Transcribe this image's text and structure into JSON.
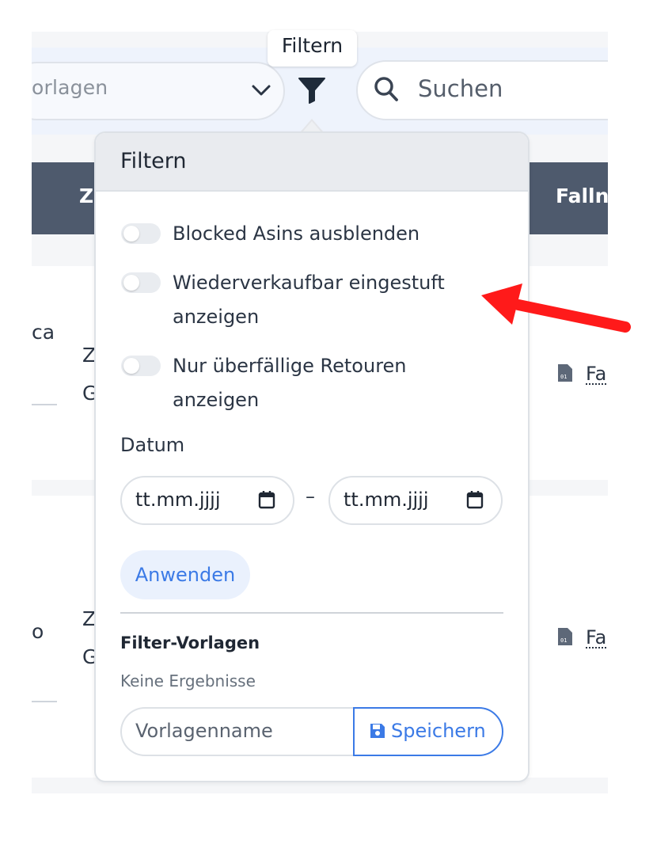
{
  "toolbar": {
    "template_select_value": "orlagen",
    "search_placeholder": "Suchen"
  },
  "tooltip": {
    "text": "Filtern"
  },
  "table": {
    "header_col_z": "Z",
    "header_col_fall": "Fallnu",
    "rows": [
      {
        "left_text": "ca",
        "col2_line1": "Z",
        "col2_line2": "G",
        "file_label": "Fa"
      },
      {
        "left_text": "o",
        "col2_line1": "Z",
        "col2_line2": "G",
        "file_label": "Fa"
      }
    ]
  },
  "filter_popover": {
    "title": "Filtern",
    "toggles": [
      {
        "label": "Blocked Asins ausblenden",
        "on": false
      },
      {
        "label": "Wiederverkaufbar eingestuft anzeigen",
        "on": false
      },
      {
        "label": "Nur überfällige Retouren anzeigen",
        "on": false
      }
    ],
    "date_label": "Datum",
    "date_from_placeholder": "tt.mm.jjjj",
    "date_separator": "–",
    "date_to_placeholder": "tt.mm.jjjj",
    "apply_label": "Anwenden",
    "templates_title": "Filter-Vorlagen",
    "templates_empty": "Keine Ergebnisse",
    "template_name_placeholder": "Vorlagenname",
    "save_label": "Speichern"
  },
  "colors": {
    "accent": "#3b7ae6",
    "header_bg": "#4e5a6d",
    "annotation_arrow": "#ff1a1a"
  },
  "icons": [
    "chevron-down-icon",
    "funnel-icon",
    "search-icon",
    "file-icon",
    "calendar-icon",
    "save-icon",
    "arrow-annotation"
  ]
}
